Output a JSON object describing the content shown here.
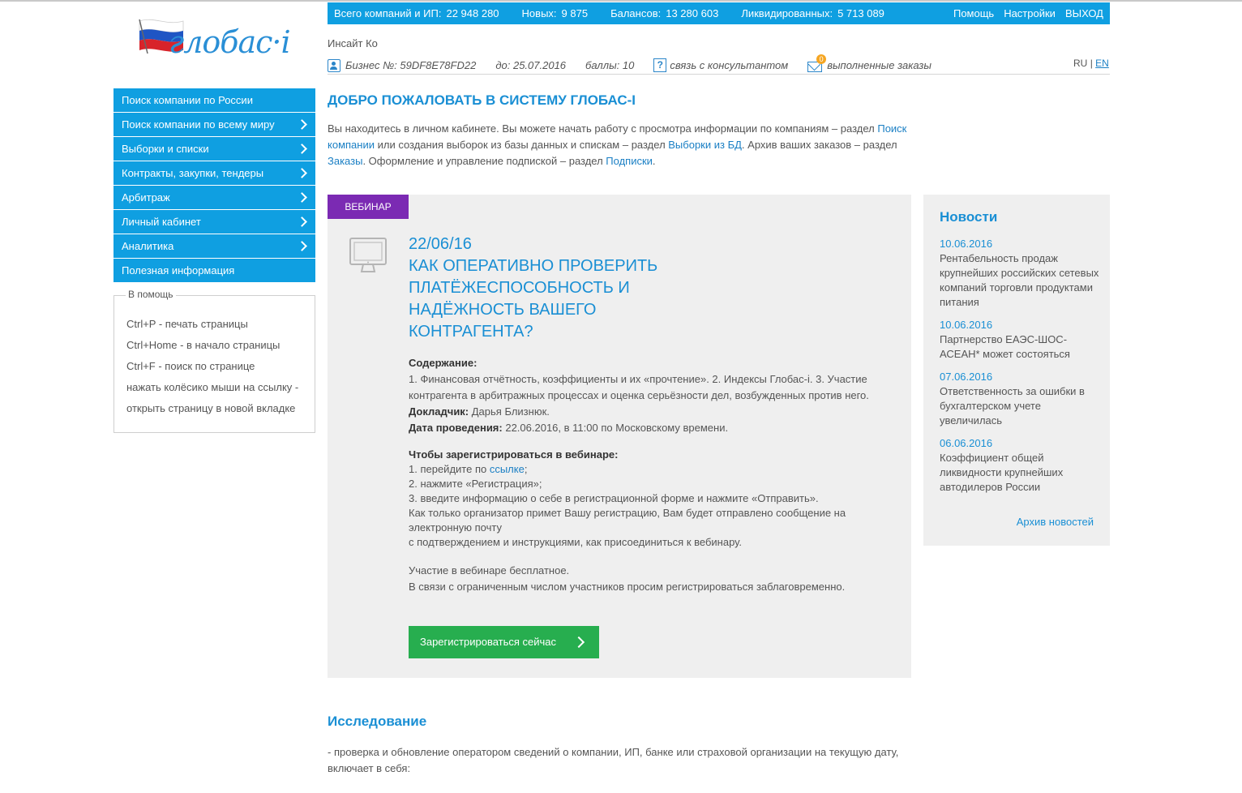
{
  "logo": {
    "text": "глобас·i"
  },
  "stats": [
    {
      "label": "Всего компаний и ИП:",
      "value": "22 948 280"
    },
    {
      "label": "Новых:",
      "value": "9 875"
    },
    {
      "label": "Балансов:",
      "value": "13 280 603"
    },
    {
      "label": "Ликвидированных:",
      "value": "5 713 089"
    }
  ],
  "topnav": {
    "help": "Помощь",
    "settings": "Настройки",
    "logout": "ВЫХОД"
  },
  "company": "Инсайт Ко",
  "userline": {
    "business": "Бизнес №: 59DF8E78FD22",
    "until": "до: 25.07.2016",
    "points": "баллы: 10",
    "consult": "связь с консультантом",
    "mail_badge": "0",
    "orders": "выполненные заказы"
  },
  "lang": {
    "ru": "RU",
    "sep": "|",
    "en": "EN"
  },
  "menu": [
    {
      "label": "Поиск компании по России",
      "arrow": false
    },
    {
      "label": "Поиск компании по всему миру",
      "arrow": true
    },
    {
      "label": "Выборки и списки",
      "arrow": true
    },
    {
      "label": "Контракты, закупки, тендеры",
      "arrow": true
    },
    {
      "label": "Арбитраж",
      "arrow": true
    },
    {
      "label": "Личный кабинет",
      "arrow": true
    },
    {
      "label": "Аналитика",
      "arrow": true
    },
    {
      "label": "Полезная информация",
      "arrow": false
    }
  ],
  "help": {
    "title": "В помощь",
    "lines": [
      "Ctrl+P - печать страницы",
      "Ctrl+Home - в начало страницы",
      "Ctrl+F - поиск по странице",
      "нажать колёсико мыши на ссылку -",
      "открыть страницу в новой вкладке"
    ]
  },
  "welcome": {
    "title": "ДОБРО ПОЖАЛОВАТЬ В СИСТЕМУ ГЛОБАС-I",
    "t1": "Вы находитесь в личном кабинете. Вы можете начать работу с просмотра информации по компаниям – раздел ",
    "l1": "Поиск компании",
    "t2": " или создания выборок из базы данных и спискам – раздел ",
    "l2": "Выборки из БД",
    "t3": ". Архив ваших заказов – раздел ",
    "l3": "Заказы",
    "t4": ". Оформление и управление подпиской – раздел ",
    "l4": "Подписки",
    "t5": "."
  },
  "webinar": {
    "tag": "ВЕБИНАР",
    "date": "22/06/16",
    "title": "КАК ОПЕРАТИВНО ПРОВЕРИТЬ ПЛАТЁЖЕСПОСОБНОСТЬ И НАДЁЖНОСТЬ ВАШЕГО КОНТРАГЕНТА?",
    "content_label": "Содержание:",
    "content": "1. Финансовая отчётность, коэффициенты и их «прочтение». 2. Индексы Глобас-i. 3. Участие контрагента в арбитражных процессах и оценка серьёзности дел, возбужденных против него.",
    "speaker_label": "Докладчик:",
    "speaker": " Дарья Близнюк.",
    "when_label": "Дата проведения:",
    "when": " 22.06.2016, в 11:00 по Московскому времени.",
    "reg_label": "Чтобы зарегистрироваться в вебинаре:",
    "step1_pre": "1. перейдите по ",
    "step1_link": "ссылке",
    "step1_post": ";",
    "step2": "2. нажмите «Регистрация»;",
    "step3": "3. введите информацию о себе в регистрационной форме и нажмите «Отправить».",
    "note1": "Как только организатор примет Вашу регистрацию, Вам будет отправлено сообщение на электронную почту",
    "note2": "с подтверждением и инструкциями, как присоединиться к вебинару.",
    "free1": "Участие в вебинаре бесплатное.",
    "free2": "В связи с ограниченным числом участников просим регистрироваться заблаговременно.",
    "button": "Зарегистрироваться сейчас"
  },
  "news": {
    "title": "Новости",
    "items": [
      {
        "date": "10.06.2016",
        "text": "Рентабельность продаж крупнейших российских сетевых компаний торговли продуктами питания"
      },
      {
        "date": "10.06.2016",
        "text": "Партнерство ЕАЭС-ШОС-АСЕАН* может состояться"
      },
      {
        "date": "07.06.2016",
        "text": "Ответственность за ошибки в бухгалтерском учете увеличилась"
      },
      {
        "date": "06.06.2016",
        "text": "Коэффициент общей ликвидности крупнейших автодилеров России"
      }
    ],
    "archive": "Архив новостей"
  },
  "research": {
    "title": "Исследование",
    "text": "- проверка и обновление оператором сведений о компании, ИП, банке или страховой организации на текущую дату, включает в себя:"
  }
}
